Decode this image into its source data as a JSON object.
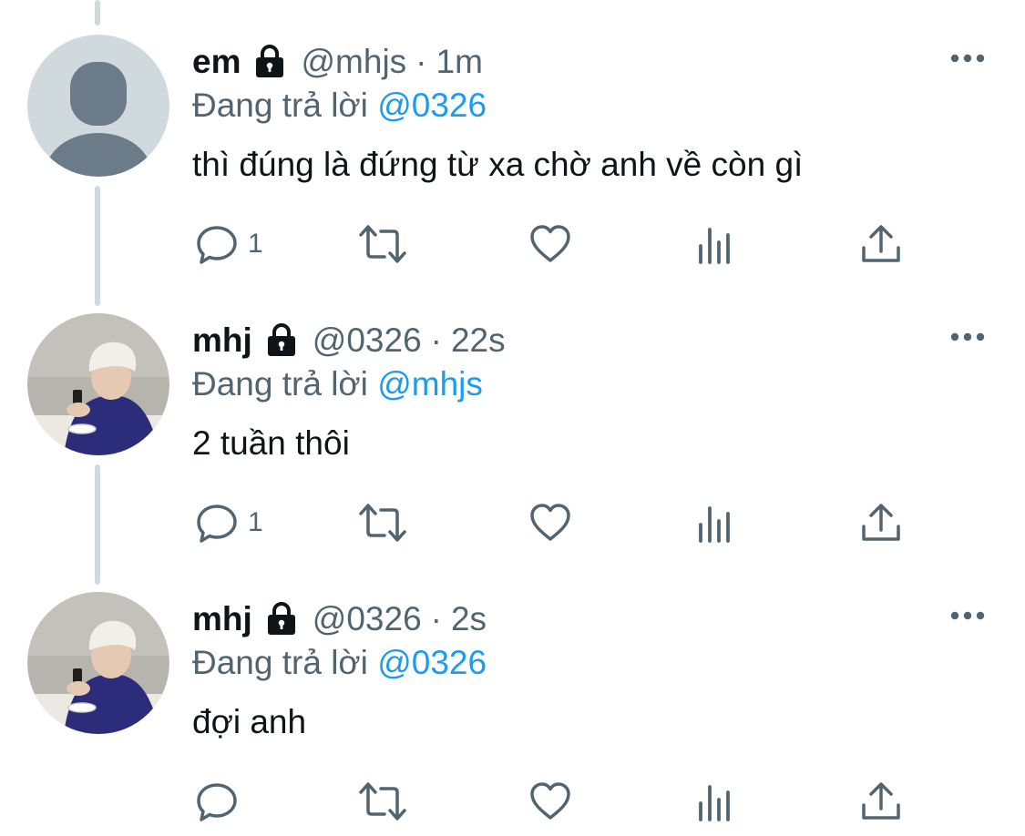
{
  "tweets": [
    {
      "display_name": "em",
      "handle": "@mhjs",
      "separator": "·",
      "time": "1m",
      "reply_prefix": "Đang trả lời",
      "reply_to": "@0326",
      "text": "thì đúng là đứng từ xa chờ anh về còn gì",
      "reply_count": "1",
      "avatar": "default-avatar",
      "icons": [
        "lock-icon",
        "more-icon",
        "reply-icon",
        "retweet-icon",
        "like-icon",
        "views-icon",
        "share-icon"
      ]
    },
    {
      "display_name": "mhj",
      "handle": "@0326",
      "separator": "·",
      "time": "22s",
      "reply_prefix": "Đang trả lời",
      "reply_to": "@mhjs",
      "text": "2 tuần thôi",
      "reply_count": "1",
      "avatar": "photo-avatar",
      "icons": [
        "lock-icon",
        "more-icon",
        "reply-icon",
        "retweet-icon",
        "like-icon",
        "views-icon",
        "share-icon"
      ]
    },
    {
      "display_name": "mhj",
      "handle": "@0326",
      "separator": "·",
      "time": "2s",
      "reply_prefix": "Đang trả lời",
      "reply_to": "@0326",
      "text": "đợi anh",
      "reply_count": "",
      "avatar": "photo-avatar",
      "icons": [
        "lock-icon",
        "more-icon",
        "reply-icon",
        "retweet-icon",
        "like-icon",
        "views-icon",
        "share-icon"
      ]
    }
  ],
  "colors": {
    "text_primary": "#0f1419",
    "text_secondary": "#536471",
    "accent": "#1d9bf0",
    "thread_line": "#cfd9de"
  }
}
